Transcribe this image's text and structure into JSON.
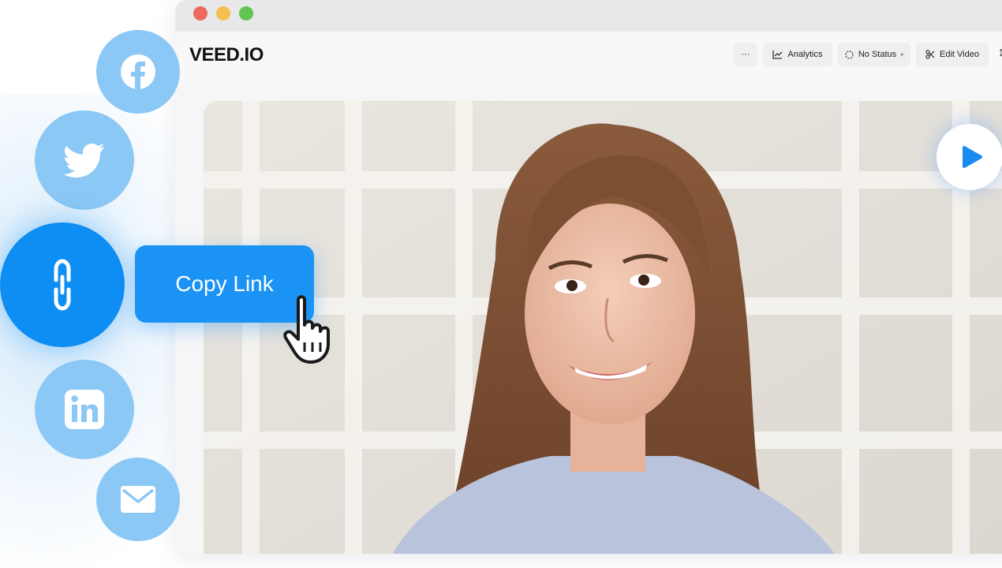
{
  "window": {
    "traffic_lights": [
      "close",
      "minimize",
      "maximize"
    ]
  },
  "app": {
    "logo": "VEED.IO"
  },
  "toolbar": {
    "more_label": "···",
    "analytics_label": "Analytics",
    "status_label": "No Status",
    "edit_label": "Edit Video",
    "edge_glyph": "↕"
  },
  "share": {
    "copy_link_label": "Copy Link",
    "items": [
      "facebook",
      "twitter",
      "link",
      "linkedin",
      "email"
    ]
  },
  "colors": {
    "accent": "#1b93f5",
    "social_light": "#8cc8f5",
    "play_icon": "#1a8cf0"
  }
}
